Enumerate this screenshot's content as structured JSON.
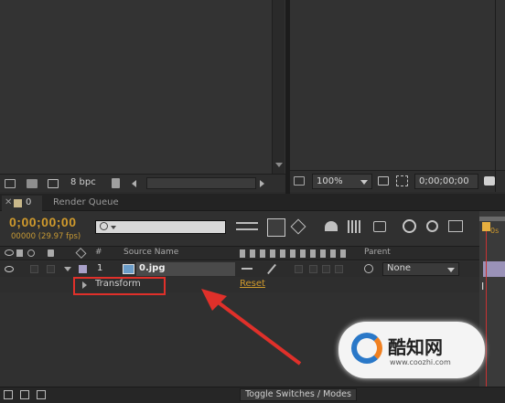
{
  "project_panel": {
    "bpc_label": "8 bpc"
  },
  "viewer": {
    "zoom": "100%",
    "timecode": "0;00;00;00"
  },
  "tabs": [
    {
      "label": "0"
    },
    {
      "label": "Render Queue"
    }
  ],
  "timeline": {
    "current_time": "0;00;00;00",
    "frame_info": "00000 (29.97 fps)",
    "columns": {
      "number": "#",
      "source_name": "Source Name",
      "parent": "Parent"
    },
    "layer": {
      "index": "1",
      "name": "0.jpg",
      "parent": "None"
    },
    "property": {
      "name": "Transform",
      "reset": "Reset"
    },
    "ruler_label": "0s",
    "toggle_label": "Toggle Switches / Modes"
  },
  "watermark": {
    "logo_text": "酷知网",
    "url": "www.coozhi.com"
  },
  "colors": {
    "timecode": "#d09a2c",
    "annotation": "#e0302a",
    "playhead": "#c83232"
  }
}
